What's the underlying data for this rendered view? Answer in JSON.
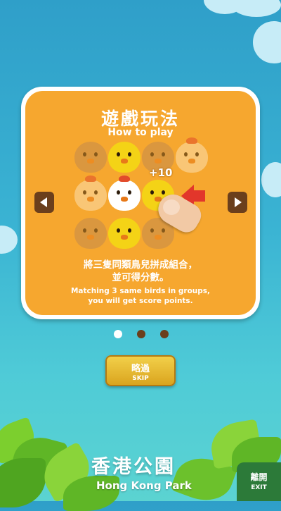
{
  "dialog": {
    "title_zh": "遊戲玩法",
    "title_en": "How to play",
    "score_popup": "+10",
    "desc_zh": "將三隻同類鳥兒拼成組合，\n並可得分數。",
    "desc_en": "Matching 3 same birds in groups,\nyou will get score points."
  },
  "pagination": {
    "current_page": 1,
    "total_pages": 3
  },
  "skip_button": {
    "label_zh": "略過",
    "label_en": "SKIP"
  },
  "footer": {
    "park_zh": "香港公園",
    "park_en": "Hong Kong Park"
  },
  "exit_button": {
    "label_zh": "離開",
    "label_en": "EXIT"
  },
  "colors": {
    "card": "#f6a72f",
    "nav": "#6b3f1c",
    "exit": "#2c7a39",
    "skip": "#e3b132"
  },
  "icons": [
    "chevron-left-icon",
    "chevron-right-icon",
    "bird-icon",
    "hand-pointer-icon",
    "red-arrow-icon"
  ]
}
